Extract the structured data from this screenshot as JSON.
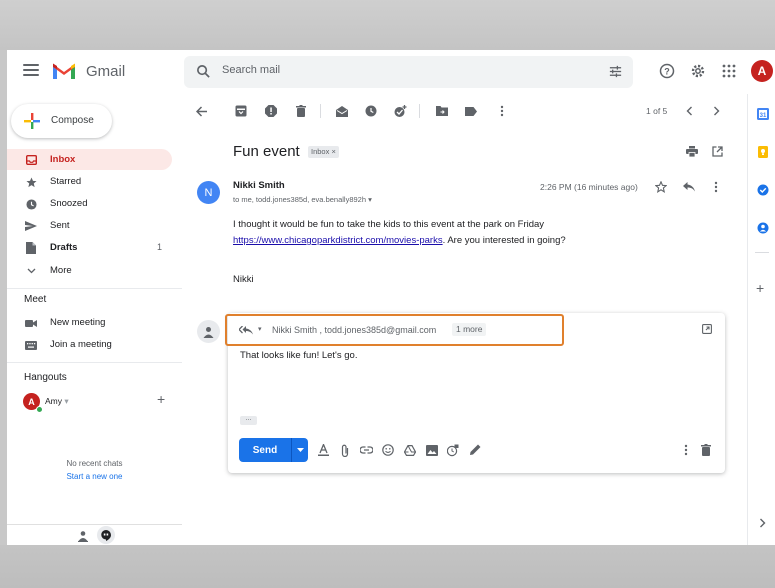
{
  "app": {
    "name": "Gmail",
    "account_initial": "A"
  },
  "search": {
    "placeholder": "Search mail"
  },
  "sidebar": {
    "compose_label": "Compose",
    "items": [
      {
        "label": "Inbox",
        "count": ""
      },
      {
        "label": "Starred",
        "count": ""
      },
      {
        "label": "Snoozed",
        "count": ""
      },
      {
        "label": "Sent",
        "count": ""
      },
      {
        "label": "Drafts",
        "count": "1"
      },
      {
        "label": "More",
        "count": ""
      }
    ],
    "meet": {
      "title": "Meet",
      "new_meeting": "New meeting",
      "join_meeting": "Join a meeting"
    },
    "hangouts": {
      "title": "Hangouts",
      "user_initial": "A",
      "user_name": "Amy",
      "no_chats": "No recent chats",
      "start_new": "Start a new one"
    }
  },
  "toolbar": {
    "pager": "1 of 5"
  },
  "message": {
    "subject": "Fun event",
    "label": "Inbox",
    "sender_initial": "N",
    "sender_name": "Nikki Smith",
    "recipients": "to me, todd.jones385d, eva.benally892h",
    "time": "2:26 PM (16 minutes ago)",
    "body_before": "I thought it would be fun to take the kids to this event at the park on Friday ",
    "link": "https://www.chicagoparkdistrict.com/movies-parks",
    "body_after": ". Are you interested in going?",
    "signature": "Nikki"
  },
  "reply": {
    "recipients": "Nikki Smith , todd.jones385d@gmail.com",
    "more": "1 more",
    "text": "That looks like fun!  Let's go.",
    "send_label": "Send"
  },
  "colors": {
    "accent": "#1a73e8",
    "inbox_active_bg": "#fce8e6",
    "inbox_active_text": "#c5221f",
    "highlight": "#e0802d"
  }
}
